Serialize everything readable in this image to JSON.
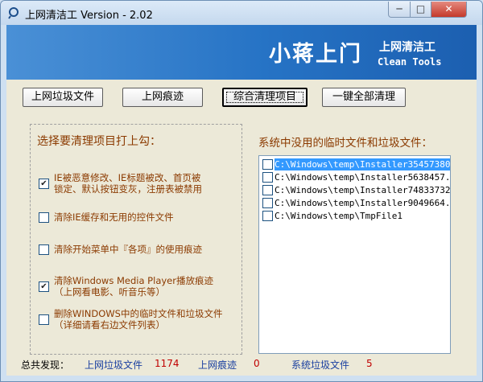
{
  "titlebar": {
    "title": "上网清洁工 Version - 2.02",
    "minimize_glyph": "─",
    "maximize_glyph": "□",
    "close_glyph": "✕",
    "icon": "app-icon"
  },
  "banner": {
    "headline": "小蒋上门",
    "product_cn": "上网清洁工",
    "product_en": "Clean Tools"
  },
  "toolbar": {
    "btn_junk": "上网垃圾文件",
    "btn_traces": "上网痕迹",
    "btn_combined": "综合清理项目",
    "btn_all": "一键全部清理"
  },
  "options": {
    "title": "选择要清理项目打上勾：",
    "items": [
      {
        "line1": "IE被恶意修改、IE标题被改、首页被",
        "line2": "锁定、默认按钮变灰，注册表被禁用",
        "checked": true
      },
      {
        "line1": "清除IE缓存和无用的控件文件",
        "line2": "",
        "checked": false
      },
      {
        "line1": "清除开始菜单中『各项』的使用痕迹",
        "line2": "",
        "checked": false
      },
      {
        "line1": "清除Windows Media Player播放痕迹",
        "line2": "（上网看电影、听音乐等）",
        "checked": true
      },
      {
        "line1": "删除WINDOWS中的临时文件和垃圾文件",
        "line2": "（详细请看右边文件列表）",
        "checked": false
      }
    ]
  },
  "files": {
    "title": "系统中没用的临时文件和垃圾文件：",
    "items": [
      "C:\\Windows\\temp\\Installer35457380",
      "C:\\Windows\\temp\\Installer5638457.",
      "C:\\Windows\\temp\\Installer74833732",
      "C:\\Windows\\temp\\Installer9049664.",
      "C:\\Windows\\temp\\TmpFile1"
    ]
  },
  "status": {
    "total_label": "总共发现：",
    "junk_label": "上网垃圾文件",
    "junk_count": "1174",
    "traces_label": "上网痕迹",
    "traces_count": "0",
    "system_label": "系统垃圾文件",
    "system_count": "5"
  },
  "colors": {
    "banner": "#2673c5",
    "option_text": "#8b3a00",
    "status_label": "#1a3fa0",
    "status_count": "#c00000",
    "selection": "#3399ff"
  }
}
